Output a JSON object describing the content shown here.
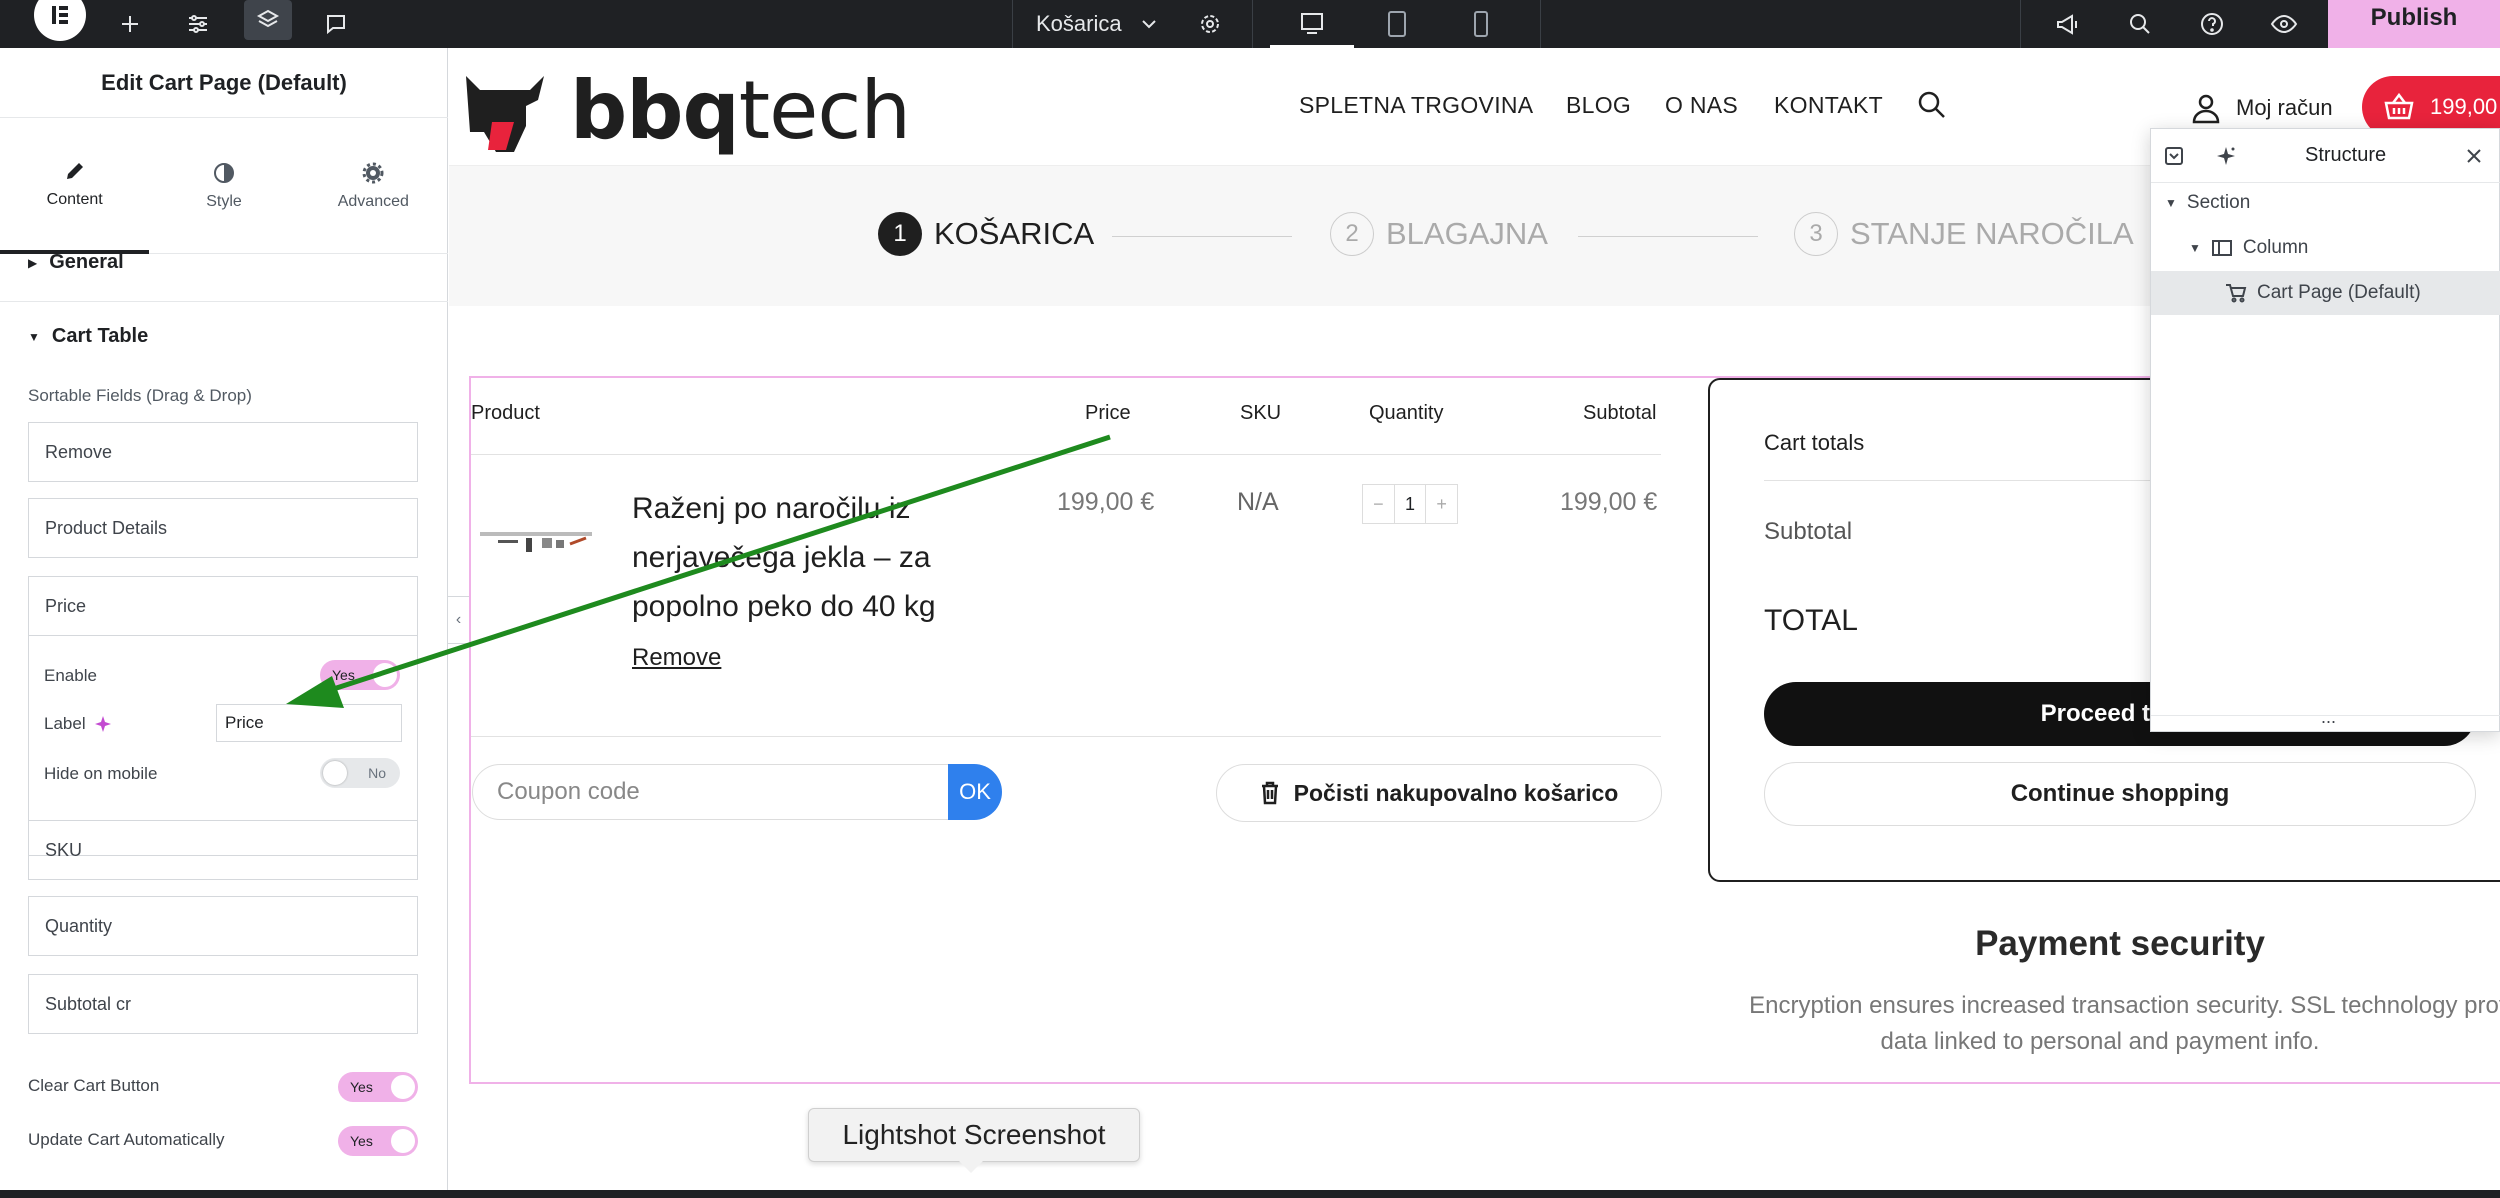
{
  "topbar": {
    "page_title": "Košarica",
    "publish_label": "Publish"
  },
  "panel": {
    "title": "Edit Cart Page (Default)",
    "tabs": [
      {
        "label": "Content"
      },
      {
        "label": "Style"
      },
      {
        "label": "Advanced"
      }
    ],
    "general_label": "General",
    "cart_table_label": "Cart Table",
    "sortable_label": "Sortable Fields (Drag & Drop)",
    "fields": {
      "remove": "Remove",
      "product_details": "Product Details",
      "price": "Price",
      "sku": "SKU",
      "quantity": "Quantity",
      "subtotal": "Subtotal cr"
    },
    "enable_label": "Enable",
    "enable_value": "Yes",
    "label_label": "Label",
    "label_value": "Price",
    "hide_mobile_label": "Hide on mobile",
    "hide_mobile_value": "No",
    "clear_cart_label": "Clear Cart Button",
    "clear_cart_value": "Yes",
    "update_cart_label": "Update Cart Automatically",
    "update_cart_value": "Yes"
  },
  "site": {
    "logo_bold": "bbq",
    "logo_light": "tech",
    "nav": [
      "SPLETNA TRGOVINA",
      "BLOG",
      "O NAS",
      "KONTAKT"
    ],
    "account_label": "Moj račun",
    "cart_amount": "199,00"
  },
  "steps": [
    {
      "num": "1",
      "label": "KOŠARICA"
    },
    {
      "num": "2",
      "label": "BLAGAJNA"
    },
    {
      "num": "3",
      "label": "STANJE NAROČILA"
    }
  ],
  "cart": {
    "headers": {
      "product": "Product",
      "price": "Price",
      "sku": "SKU",
      "quantity": "Quantity",
      "subtotal": "Subtotal"
    },
    "item": {
      "name": "Raženj po naročilu iz nerjavečega jekla – za popolno peko do 40 kg",
      "remove": "Remove",
      "price": "199,00 €",
      "sku": "N/A",
      "qty": "1",
      "qty_minus": "−",
      "qty_plus": "+",
      "subtotal": "199,00 €"
    },
    "coupon_placeholder": "Coupon code",
    "ok_label": "OK",
    "clear_label": "Počisti nakupovalno košarico"
  },
  "totals": {
    "title": "Cart totals",
    "subtotal_label": "Subtotal",
    "total_label": "TOTAL",
    "proceed_label": "Proceed to ch",
    "continue_label": "Continue shopping"
  },
  "payment": {
    "title": "Payment security",
    "line1": "Encryption ensures increased transaction security. SSL technology protec",
    "line2": "data linked to personal and payment info."
  },
  "structure": {
    "title": "Structure",
    "rows": [
      "Section",
      "Column",
      "Cart Page (Default)"
    ],
    "more": "..."
  },
  "tooltip": "Lightshot Screenshot",
  "colors": {
    "accent_pink": "#f0b1e8",
    "brand_red": "#e8233c",
    "arrow_green": "#1e8a1e",
    "ok_blue": "#2f80ed"
  }
}
